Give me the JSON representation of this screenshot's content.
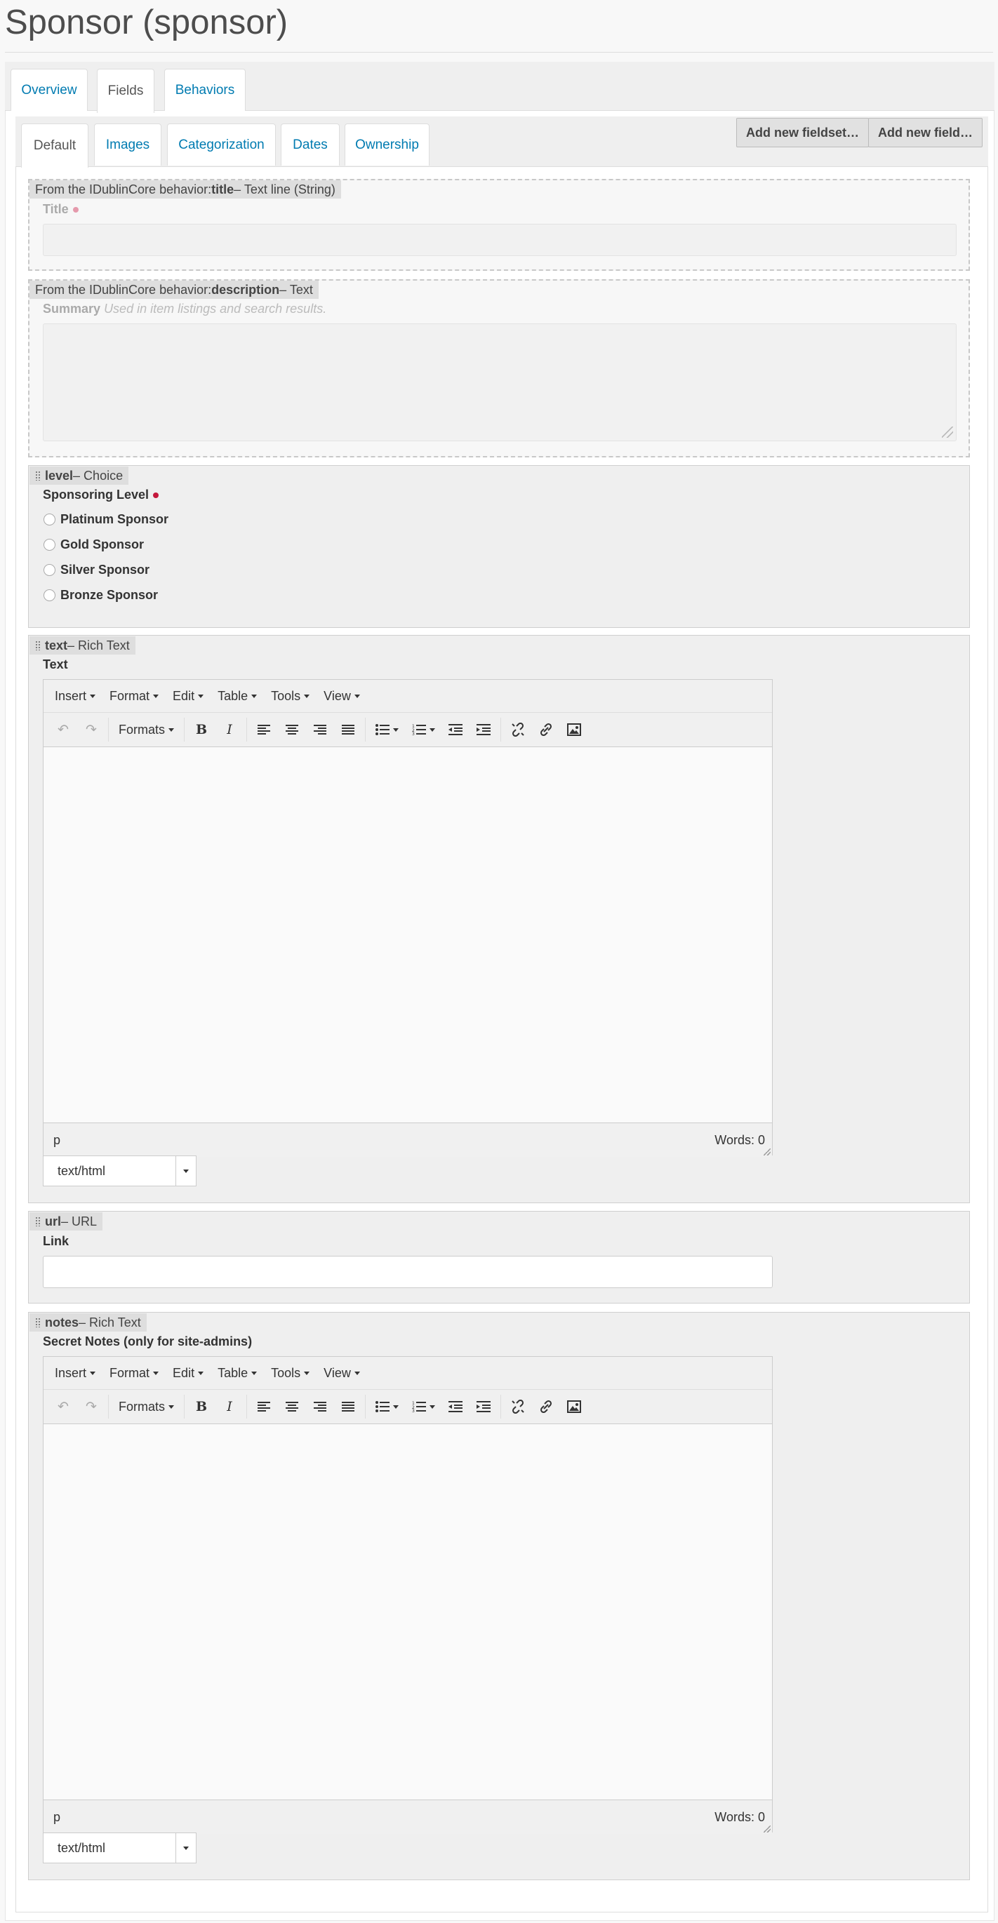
{
  "page": {
    "title": "Sponsor (sponsor)"
  },
  "outer_tabs": [
    {
      "label": "Overview"
    },
    {
      "label": "Fields"
    },
    {
      "label": "Behaviors"
    }
  ],
  "inner_tabs": [
    {
      "label": "Default"
    },
    {
      "label": "Images"
    },
    {
      "label": "Categorization"
    },
    {
      "label": "Dates"
    },
    {
      "label": "Ownership"
    }
  ],
  "actions": {
    "add_fieldset": "Add new fieldset…",
    "add_field": "Add new field…"
  },
  "fields": {
    "title": {
      "legend_prefix": "From the IDublinCore behavior: ",
      "legend_name": "title",
      "legend_type": " – Text line (String)",
      "label": "Title",
      "value": ""
    },
    "description": {
      "legend_prefix": "From the IDublinCore behavior: ",
      "legend_name": "description",
      "legend_type": " – Text",
      "label": "Summary",
      "help": "Used in item listings and search results.",
      "value": ""
    },
    "level": {
      "legend_name": "level",
      "legend_type": " – Choice",
      "label": "Sponsoring Level",
      "options": [
        "Platinum Sponsor",
        "Gold Sponsor",
        "Silver Sponsor",
        "Bronze Sponsor"
      ]
    },
    "text": {
      "legend_name": "text",
      "legend_type": " – Rich Text",
      "label": "Text",
      "path": "p",
      "words": "Words: 0",
      "mimetype": "text/html"
    },
    "url": {
      "legend_name": "url",
      "legend_type": " – URL",
      "label": "Link",
      "value": ""
    },
    "notes": {
      "legend_name": "notes",
      "legend_type": " – Rich Text",
      "label": "Secret Notes (only for site-admins)",
      "path": "p",
      "words": "Words: 0",
      "mimetype": "text/html"
    }
  },
  "editor": {
    "menus": [
      "Insert",
      "Format",
      "Edit",
      "Table",
      "Tools",
      "View"
    ],
    "formats_label": "Formats"
  },
  "colors": {
    "link": "#007bb1",
    "required": "#c4183c"
  }
}
